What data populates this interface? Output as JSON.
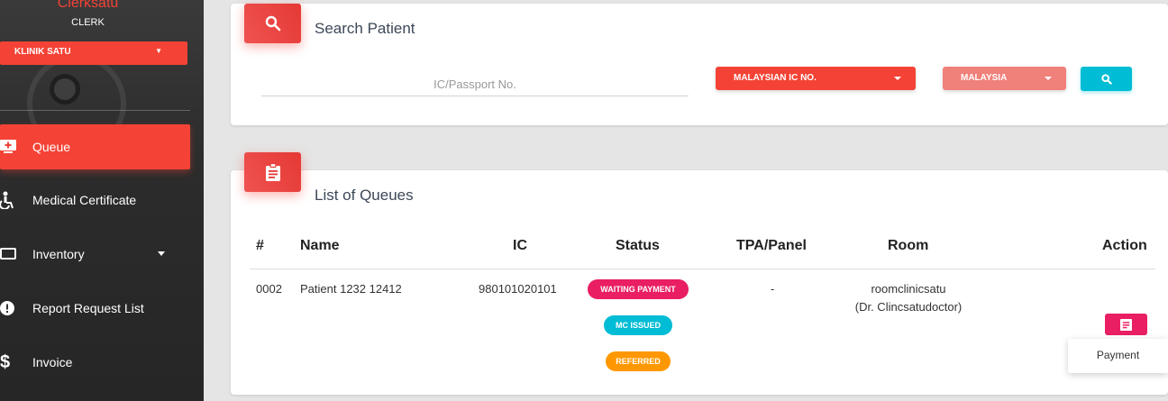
{
  "sidebar": {
    "user_name": "Clerksatu",
    "user_role": "CLERK",
    "clinic": "KLINIK SATU",
    "items": [
      {
        "label": "Queue",
        "icon": "add-to-queue-icon",
        "active": true
      },
      {
        "label": "Medical Certificate",
        "icon": "accessible-icon",
        "active": false
      },
      {
        "label": "Inventory",
        "icon": "monitor-icon",
        "active": false,
        "has_submenu": true
      },
      {
        "label": "Report Request List",
        "icon": "alert-circle-icon",
        "active": false
      },
      {
        "label": "Invoice",
        "icon": "dollar-icon",
        "active": false
      }
    ]
  },
  "search": {
    "title": "Search Patient",
    "ic_placeholder": "IC/Passport No.",
    "id_type": "MALAYSIAN IC NO.",
    "country": "MALAYSIA"
  },
  "queues": {
    "title": "List of Queues",
    "columns": [
      "#",
      "Name",
      "IC",
      "Status",
      "TPA/Panel",
      "Room",
      "Action"
    ],
    "rows": [
      {
        "no": "0002",
        "name": "Patient 1232 12412",
        "ic": "980101020101",
        "statuses": [
          "WAITING PAYMENT",
          "MC ISSUED",
          "REFERRED"
        ],
        "panel": "-",
        "room": "roomclinicsatu",
        "doctor": "(Dr. Clincsatudoctor)"
      }
    ],
    "action_menu": [
      "Payment"
    ]
  },
  "colors": {
    "primary": "#f44336",
    "info": "#00bcd4",
    "rose": "#e91e63",
    "warning": "#ff9800",
    "country_select": "#f0807a"
  }
}
